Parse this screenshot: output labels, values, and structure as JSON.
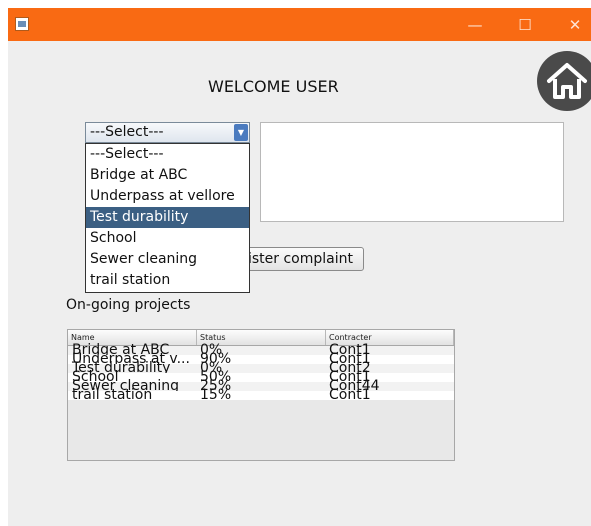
{
  "window": {
    "min_glyph": "—",
    "max_glyph": "☐",
    "close_glyph": "✕",
    "accent": "#f96a13"
  },
  "welcome": "WELCOME USER",
  "home_icon": "home-icon",
  "combo": {
    "selected": "---Select---"
  },
  "dropdown": {
    "items": [
      "---Select---",
      "Bridge at ABC",
      "Underpass at vellore",
      "Test durability",
      "School",
      "Sewer cleaning",
      "trail station"
    ],
    "highlighted": "Test durability"
  },
  "register_button": "Register complaint",
  "ongoing_label": "On-going projects",
  "table": {
    "headers": [
      "Name",
      "Status",
      "Contracter"
    ],
    "rows": [
      [
        "Bridge at ABC",
        "0%",
        "Cont1"
      ],
      [
        "Underpass at v...",
        "90%",
        "Cont1"
      ],
      [
        "Test durability",
        "0%",
        "Cont2"
      ],
      [
        "School",
        "50%",
        "Cont1"
      ],
      [
        "Sewer cleaning",
        "25%",
        "Cont44"
      ],
      [
        "trail station",
        "15%",
        "Cont1"
      ]
    ]
  }
}
